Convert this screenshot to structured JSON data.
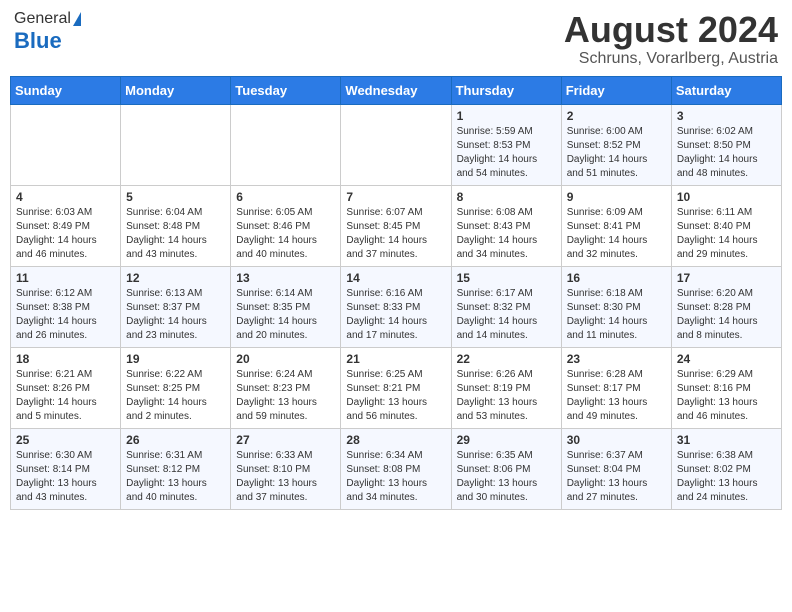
{
  "header": {
    "logo_general": "General",
    "logo_blue": "Blue",
    "month_year": "August 2024",
    "location": "Schruns, Vorarlberg, Austria"
  },
  "days_of_week": [
    "Sunday",
    "Monday",
    "Tuesday",
    "Wednesday",
    "Thursday",
    "Friday",
    "Saturday"
  ],
  "weeks": [
    [
      {
        "day": "",
        "info": ""
      },
      {
        "day": "",
        "info": ""
      },
      {
        "day": "",
        "info": ""
      },
      {
        "day": "",
        "info": ""
      },
      {
        "day": "1",
        "info": "Sunrise: 5:59 AM\nSunset: 8:53 PM\nDaylight: 14 hours\nand 54 minutes."
      },
      {
        "day": "2",
        "info": "Sunrise: 6:00 AM\nSunset: 8:52 PM\nDaylight: 14 hours\nand 51 minutes."
      },
      {
        "day": "3",
        "info": "Sunrise: 6:02 AM\nSunset: 8:50 PM\nDaylight: 14 hours\nand 48 minutes."
      }
    ],
    [
      {
        "day": "4",
        "info": "Sunrise: 6:03 AM\nSunset: 8:49 PM\nDaylight: 14 hours\nand 46 minutes."
      },
      {
        "day": "5",
        "info": "Sunrise: 6:04 AM\nSunset: 8:48 PM\nDaylight: 14 hours\nand 43 minutes."
      },
      {
        "day": "6",
        "info": "Sunrise: 6:05 AM\nSunset: 8:46 PM\nDaylight: 14 hours\nand 40 minutes."
      },
      {
        "day": "7",
        "info": "Sunrise: 6:07 AM\nSunset: 8:45 PM\nDaylight: 14 hours\nand 37 minutes."
      },
      {
        "day": "8",
        "info": "Sunrise: 6:08 AM\nSunset: 8:43 PM\nDaylight: 14 hours\nand 34 minutes."
      },
      {
        "day": "9",
        "info": "Sunrise: 6:09 AM\nSunset: 8:41 PM\nDaylight: 14 hours\nand 32 minutes."
      },
      {
        "day": "10",
        "info": "Sunrise: 6:11 AM\nSunset: 8:40 PM\nDaylight: 14 hours\nand 29 minutes."
      }
    ],
    [
      {
        "day": "11",
        "info": "Sunrise: 6:12 AM\nSunset: 8:38 PM\nDaylight: 14 hours\nand 26 minutes."
      },
      {
        "day": "12",
        "info": "Sunrise: 6:13 AM\nSunset: 8:37 PM\nDaylight: 14 hours\nand 23 minutes."
      },
      {
        "day": "13",
        "info": "Sunrise: 6:14 AM\nSunset: 8:35 PM\nDaylight: 14 hours\nand 20 minutes."
      },
      {
        "day": "14",
        "info": "Sunrise: 6:16 AM\nSunset: 8:33 PM\nDaylight: 14 hours\nand 17 minutes."
      },
      {
        "day": "15",
        "info": "Sunrise: 6:17 AM\nSunset: 8:32 PM\nDaylight: 14 hours\nand 14 minutes."
      },
      {
        "day": "16",
        "info": "Sunrise: 6:18 AM\nSunset: 8:30 PM\nDaylight: 14 hours\nand 11 minutes."
      },
      {
        "day": "17",
        "info": "Sunrise: 6:20 AM\nSunset: 8:28 PM\nDaylight: 14 hours\nand 8 minutes."
      }
    ],
    [
      {
        "day": "18",
        "info": "Sunrise: 6:21 AM\nSunset: 8:26 PM\nDaylight: 14 hours\nand 5 minutes."
      },
      {
        "day": "19",
        "info": "Sunrise: 6:22 AM\nSunset: 8:25 PM\nDaylight: 14 hours\nand 2 minutes."
      },
      {
        "day": "20",
        "info": "Sunrise: 6:24 AM\nSunset: 8:23 PM\nDaylight: 13 hours\nand 59 minutes."
      },
      {
        "day": "21",
        "info": "Sunrise: 6:25 AM\nSunset: 8:21 PM\nDaylight: 13 hours\nand 56 minutes."
      },
      {
        "day": "22",
        "info": "Sunrise: 6:26 AM\nSunset: 8:19 PM\nDaylight: 13 hours\nand 53 minutes."
      },
      {
        "day": "23",
        "info": "Sunrise: 6:28 AM\nSunset: 8:17 PM\nDaylight: 13 hours\nand 49 minutes."
      },
      {
        "day": "24",
        "info": "Sunrise: 6:29 AM\nSunset: 8:16 PM\nDaylight: 13 hours\nand 46 minutes."
      }
    ],
    [
      {
        "day": "25",
        "info": "Sunrise: 6:30 AM\nSunset: 8:14 PM\nDaylight: 13 hours\nand 43 minutes."
      },
      {
        "day": "26",
        "info": "Sunrise: 6:31 AM\nSunset: 8:12 PM\nDaylight: 13 hours\nand 40 minutes."
      },
      {
        "day": "27",
        "info": "Sunrise: 6:33 AM\nSunset: 8:10 PM\nDaylight: 13 hours\nand 37 minutes."
      },
      {
        "day": "28",
        "info": "Sunrise: 6:34 AM\nSunset: 8:08 PM\nDaylight: 13 hours\nand 34 minutes."
      },
      {
        "day": "29",
        "info": "Sunrise: 6:35 AM\nSunset: 8:06 PM\nDaylight: 13 hours\nand 30 minutes."
      },
      {
        "day": "30",
        "info": "Sunrise: 6:37 AM\nSunset: 8:04 PM\nDaylight: 13 hours\nand 27 minutes."
      },
      {
        "day": "31",
        "info": "Sunrise: 6:38 AM\nSunset: 8:02 PM\nDaylight: 13 hours\nand 24 minutes."
      }
    ]
  ]
}
